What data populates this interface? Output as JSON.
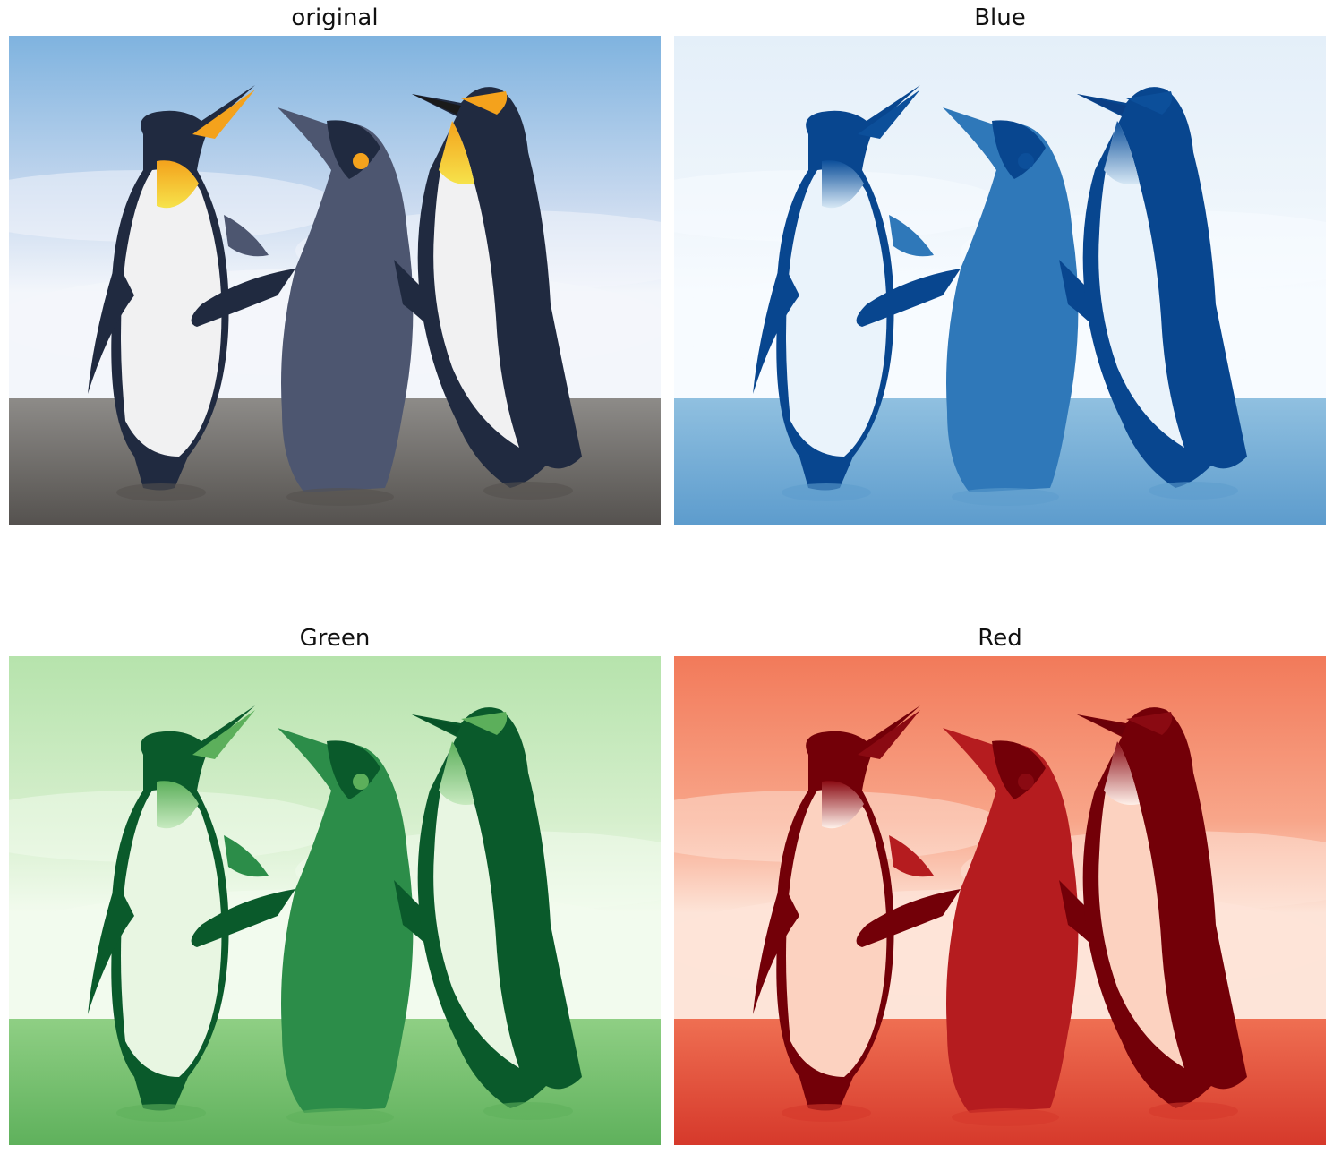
{
  "panels": [
    {
      "title": "original",
      "palette": {
        "sky_top": "#7fb3df",
        "sky_mid": "#c8d9ef",
        "cloud": "#f3f6fb",
        "ground": "#8d8b88",
        "ground_dark": "#55524f",
        "body_dark": "#202a40",
        "body_mid": "#4d5670",
        "belly": "#f1f1f2",
        "accent": "#f4a21c",
        "accent2": "#f6e34b",
        "beak": "#1a1a1a"
      }
    },
    {
      "title": "Blue",
      "palette": {
        "sky_top": "#e4eff9",
        "sky_mid": "#eef5fb",
        "cloud": "#f7fbff",
        "ground": "#90c0e0",
        "ground_dark": "#5d9ccd",
        "body_dark": "#08468f",
        "body_mid": "#2f78b9",
        "belly": "#eaf3fb",
        "accent": "#0c4f9a",
        "accent2": "#d7e8f5",
        "beak": "#0a3f85"
      }
    },
    {
      "title": "Green",
      "palette": {
        "sky_top": "#b6e3ac",
        "sky_mid": "#d6efcd",
        "cloud": "#f2fbee",
        "ground": "#8fcf84",
        "ground_dark": "#5fb15c",
        "body_dark": "#0a5a2b",
        "body_mid": "#2c8d49",
        "belly": "#e8f6e2",
        "accent": "#5caf5b",
        "accent2": "#c8eac0",
        "beak": "#075227"
      }
    },
    {
      "title": "Red",
      "palette": {
        "sky_top": "#f27a5a",
        "sky_mid": "#f8a68a",
        "cloud": "#fde4d8",
        "ground": "#ef6f52",
        "ground_dark": "#d6392b",
        "body_dark": "#730008",
        "body_mid": "#b51c1f",
        "belly": "#fcd2c0",
        "accent": "#8a0a12",
        "accent2": "#fff1ea",
        "beak": "#6a0009"
      }
    }
  ]
}
